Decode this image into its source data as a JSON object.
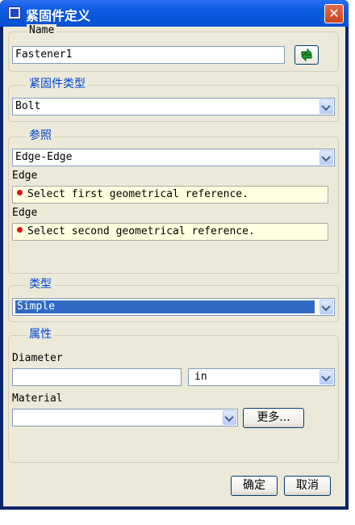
{
  "window": {
    "title": "紧固件定义"
  },
  "name_group": {
    "legend": "Name",
    "value": "Fastener1"
  },
  "fastener_type_group": {
    "legend": "紧固件类型",
    "selected": "Bolt"
  },
  "reference_group": {
    "legend": "参照",
    "selected": "Edge-Edge",
    "first_label": "Edge",
    "first_message": "Select first geometrical reference.",
    "second_label": "Edge",
    "second_message": "Select second geometrical reference."
  },
  "type_group": {
    "legend": "类型",
    "selected": "Simple"
  },
  "property_group": {
    "legend": "属性",
    "diameter_label": "Diameter",
    "diameter_value": "",
    "unit_selected": "in",
    "material_label": "Material",
    "material_value": "",
    "more_button": "更多..."
  },
  "footer": {
    "ok_button": "确定",
    "cancel_button": "取消"
  },
  "icons": {
    "title": "window-icon",
    "close": "close-icon",
    "pick": "green-select-arrow-icon"
  }
}
